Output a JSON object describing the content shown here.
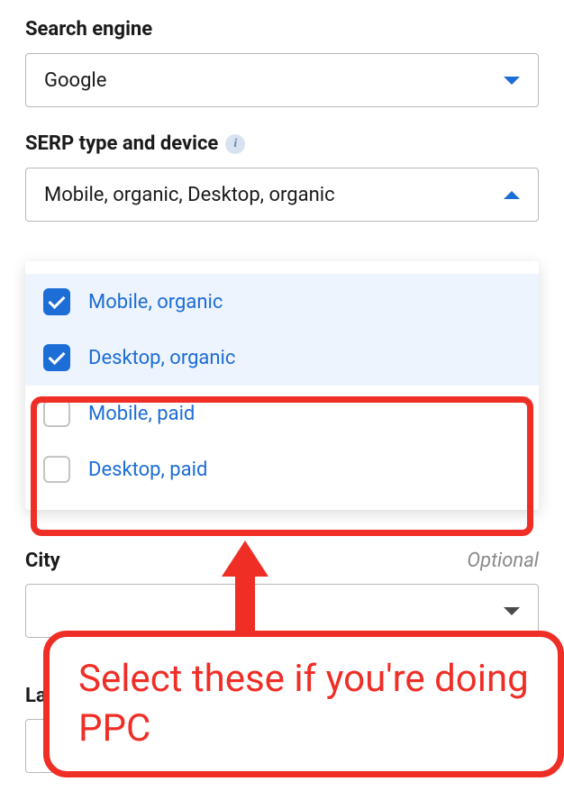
{
  "search_engine": {
    "label": "Search engine",
    "value": "Google"
  },
  "serp_type": {
    "label": "SERP type and device",
    "value": "Mobile, organic, Desktop, organic",
    "options": [
      {
        "label": "Mobile, organic",
        "checked": true
      },
      {
        "label": "Desktop, organic",
        "checked": true
      },
      {
        "label": "Mobile, paid",
        "checked": false
      },
      {
        "label": "Desktop, paid",
        "checked": false
      }
    ]
  },
  "city": {
    "label": "City",
    "optional_text": "Optional"
  },
  "lang": {
    "label_partial": "La"
  },
  "annotation": {
    "text": "Select these if you're doing PPC"
  }
}
